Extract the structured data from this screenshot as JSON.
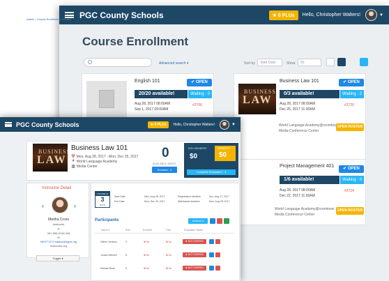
{
  "app": {
    "brand": "PGC County Schools",
    "plus_badge": "★ 0 PLUs",
    "hello": "Hello, Christopher Walters!"
  },
  "enrollment": {
    "title": "Course Enrollment",
    "advanced_search": "Advanced search ▾",
    "sort_label": "Sort by",
    "sort_value": "Start Date",
    "show_label": "Show",
    "show_value": "50",
    "cards": [
      {
        "title": "English 101",
        "status": "✔ OPEN",
        "available": "20/20 available!",
        "waiting": "Waiting : 0",
        "start": "Aug 28, 2017 08:00AM",
        "end": "Sep 1, 2017 09:00AM",
        "code": "#2706"
      },
      {
        "title": "Business Law 101",
        "status": "✔ OPEN",
        "available": "0/3 available!",
        "waiting": "Waiting : 2",
        "start": "Aug 28, 2017 08:00AM",
        "end": "Dec 25, 2017 11:00AM",
        "code": "#2720",
        "location": "World Language Academy@roomtown",
        "location2": "Media Conference Center",
        "roster": "OPEN ROSTER"
      },
      {
        "title": "Project Management 401",
        "status": "✔ OPEN",
        "available": "1/6 available!",
        "waiting": "Waiting : 0",
        "start": "Aug 28, 2017 08:00AM",
        "end": "Dec 22, 2017 11:00AM",
        "code": "#2724",
        "location": "World Language Academy@roomtown",
        "location2": "Media Conference Center",
        "roster": "OPEN ROSTER"
      }
    ]
  },
  "detail": {
    "breadcrumbs": [
      "Admin",
      "Course Enrollments",
      "Detail"
    ],
    "course_title": "Business Law 101",
    "dates": "Mon, Aug 28, 2017 - Mon, Dec 25, 2017",
    "location": "World Language Academy",
    "room": "Media Center",
    "available_seats": "0",
    "available_label": "AVAILABLE SEATS",
    "enrolled_btn": "Enrolled : 3",
    "non_member_label": "NON MEMBERS",
    "non_member_value": "$0",
    "member_label": "MEMBERS",
    "member_value": "$0",
    "complete_btn": "Complete Evaluation : 3",
    "instructor": {
      "heading": "Instructor Detail",
      "name": "Martha Cross",
      "role": "Instructor",
      "phone": "301-555-0146 246",
      "email": "NEGT1272.kaplan@pgcs.org",
      "room": "maccross.org",
      "toggle": "Toggle ▾"
    },
    "schedule": {
      "cal_top": "COURSE IN",
      "cal_num": "3",
      "cal_unit": "DAYS",
      "start_lbl": "Start Date",
      "start_val": "Mon, Aug 28, 2017",
      "end_lbl": "End Date",
      "end_val": "Mon, Dec 25, 2017",
      "reg_lbl": "Registration deadline",
      "reg_val": "Sun, Aug 27, 2017",
      "wd_lbl": "Withdrawal deadline",
      "wd_val": "Mon, Aug 28, 2017"
    },
    "participants": {
      "heading": "Participants",
      "actions_btn": "Actions ▾",
      "columns": [
        "Name ▾",
        "Role",
        "Enrolled",
        "Paid",
        "Evaluation Status"
      ],
      "rows": [
        {
          "name": "Gilbert Jackson",
          "role": "S",
          "enrolled": "✖ No",
          "paid": "✖ No",
          "status": "✖ NOT STARTED"
        },
        {
          "name": "Jordan Mitchell",
          "role": "S",
          "enrolled": "✖ No",
          "paid": "✖ No",
          "status": "✖ NOT STARTED"
        },
        {
          "name": "Michael Bush",
          "role": "S",
          "enrolled": "✖ No",
          "paid": "✖ No",
          "status": "✖ NOT STARTED"
        }
      ]
    }
  },
  "colors": {
    "navy": "#1e4766",
    "blue": "#1e88e5",
    "cyan": "#29b6f6",
    "gold": "#f5b400",
    "red": "#d9534f",
    "green": "#2e9e4f"
  }
}
